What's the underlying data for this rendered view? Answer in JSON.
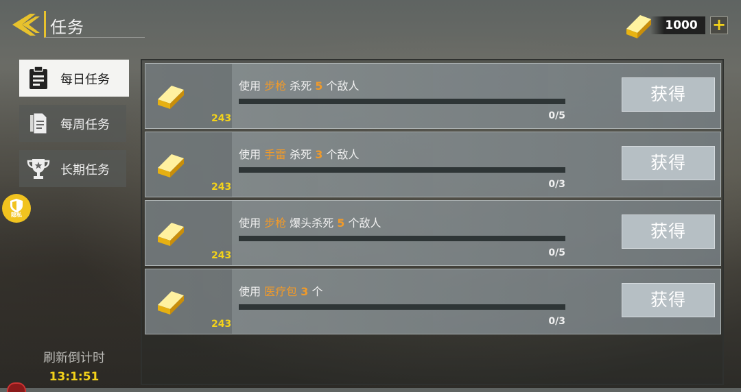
{
  "header": {
    "title": "任务",
    "gold": "1000",
    "plus": "+"
  },
  "tabs": [
    {
      "label": "每日任务",
      "icon": "clipboard-icon",
      "active": true
    },
    {
      "label": "每周任务",
      "icon": "documents-icon",
      "active": false
    },
    {
      "label": "长期任务",
      "icon": "trophy-icon",
      "active": false
    }
  ],
  "privacy_badge": "隐私",
  "refresh": {
    "label": "刷新倒计时",
    "time": "13:1:51"
  },
  "tasks": [
    {
      "pre": "使用 ",
      "item": "步枪",
      "mid": " 杀死",
      "count": "5",
      "post": "个敌人",
      "reward": "243",
      "progress": "0/5",
      "button": "获得"
    },
    {
      "pre": "使用 ",
      "item": "手雷",
      "mid": " 杀死",
      "count": "3",
      "post": "个敌人",
      "reward": "243",
      "progress": "0/3",
      "button": "获得"
    },
    {
      "pre": "使用 ",
      "item": "步枪",
      "mid": " 爆头杀死",
      "count": "5",
      "post": "个敌人",
      "reward": "243",
      "progress": "0/5",
      "button": "获得"
    },
    {
      "pre": "使用 ",
      "item": "医疗包",
      "mid": "",
      "count": "3",
      "post": "个",
      "reward": "243",
      "progress": "0/3",
      "button": "获得"
    }
  ],
  "colors": {
    "accent": "#f3d21a",
    "highlight": "#f09a2a"
  }
}
